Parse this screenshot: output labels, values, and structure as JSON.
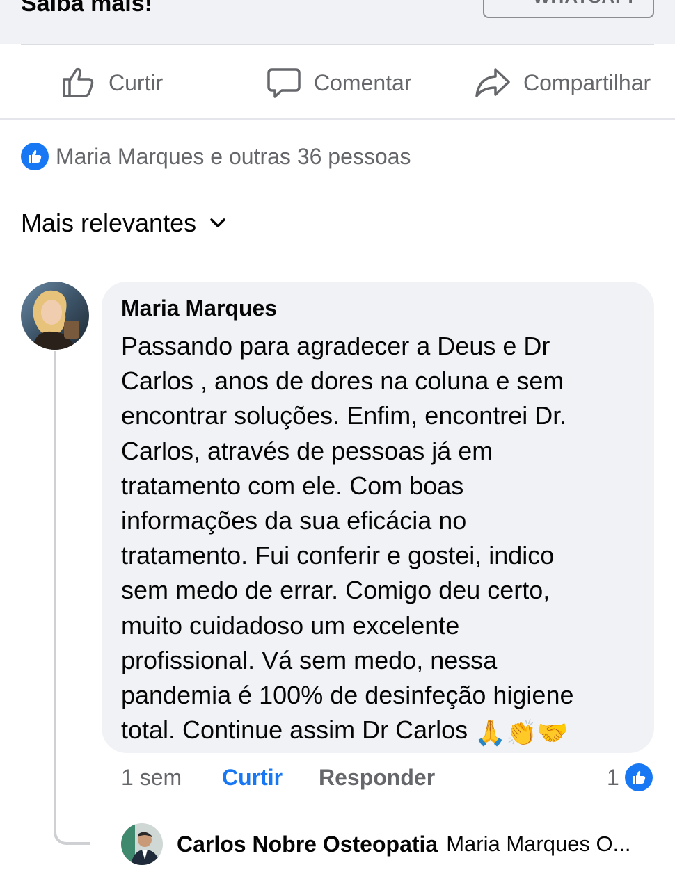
{
  "cta": {
    "text": "Saiba mais!",
    "button_label": "WHATSAPP"
  },
  "actions": {
    "like": "Curtir",
    "comment": "Comentar",
    "share": "Compartilhar"
  },
  "reactions": {
    "summary": "Maria Marques e outras 36 pessoas"
  },
  "sort": {
    "label": "Mais relevantes"
  },
  "comment": {
    "author": "Maria Marques",
    "text": "Passando para agradecer a Deus e Dr\nCarlos , anos de dores na coluna e sem\nencontrar soluções.  Enfim, encontrei  Dr.\nCarlos, através de pessoas já em\ntratamento com ele. Com boas\ninformações da sua eficácia no\ntratamento. Fui conferir e gostei, indico\nsem medo de errar. Comigo deu certo,\nmuito cuidadoso um excelente\nprofissional. Vá sem medo, nessa\npandemia é 100% de desinfeção higiene\ntotal.  Continue assim  Dr Carlos ",
    "emojis": "🙏👏🤝",
    "time": "1 sem",
    "like_label": "Curtir",
    "reply_label": "Responder",
    "like_count": "1"
  },
  "reply": {
    "author": "Carlos Nobre Osteopatia",
    "snippet": "Maria Marques O..."
  },
  "colors": {
    "accent": "#1877f2",
    "secondary_text": "#65676b",
    "bubble": "#f0f2f5"
  }
}
